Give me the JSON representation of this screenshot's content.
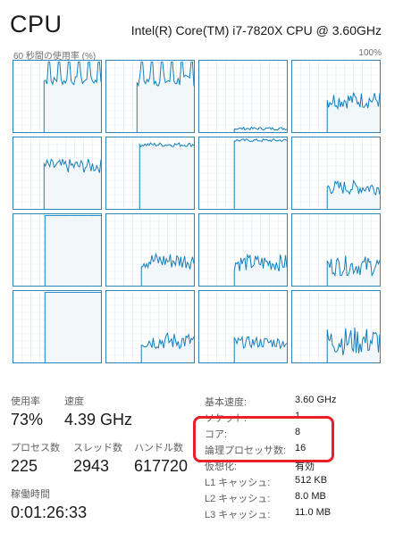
{
  "header": {
    "title": "CPU",
    "processor_name": "Intel(R) Core(TM) i7-7820X CPU @ 3.60GHz"
  },
  "graph": {
    "axis_left": "60 秒間の使用率 (%)",
    "axis_right": "100%",
    "line_color": "#117dbb",
    "fill_color": "#f1f6fa",
    "grid_color": "#d9eaf4",
    "border_color": "#2c86bb"
  },
  "stats": {
    "usage_label": "使用率",
    "usage_value": "73%",
    "speed_label": "速度",
    "speed_value": "4.39 GHz",
    "processes_label": "プロセス数",
    "processes_value": "225",
    "threads_label": "スレッド数",
    "threads_value": "2943",
    "handles_label": "ハンドル数",
    "handles_value": "617720",
    "uptime_label": "稼働時間",
    "uptime_value": "0:01:26:33"
  },
  "details": [
    {
      "label": "基本速度:",
      "value": "3.60 GHz"
    },
    {
      "label": "ソケット:",
      "value": "1"
    },
    {
      "label": "コア:",
      "value": "8"
    },
    {
      "label": "論理プロセッサ数:",
      "value": "16"
    },
    {
      "label": "仮想化:",
      "value": "有効"
    },
    {
      "label": "L1 キャッシュ:",
      "value": "512 KB"
    },
    {
      "label": "L2 キャッシュ:",
      "value": "8.0 MB"
    },
    {
      "label": "L3 キャッシュ:",
      "value": "11.0 MB"
    }
  ]
}
